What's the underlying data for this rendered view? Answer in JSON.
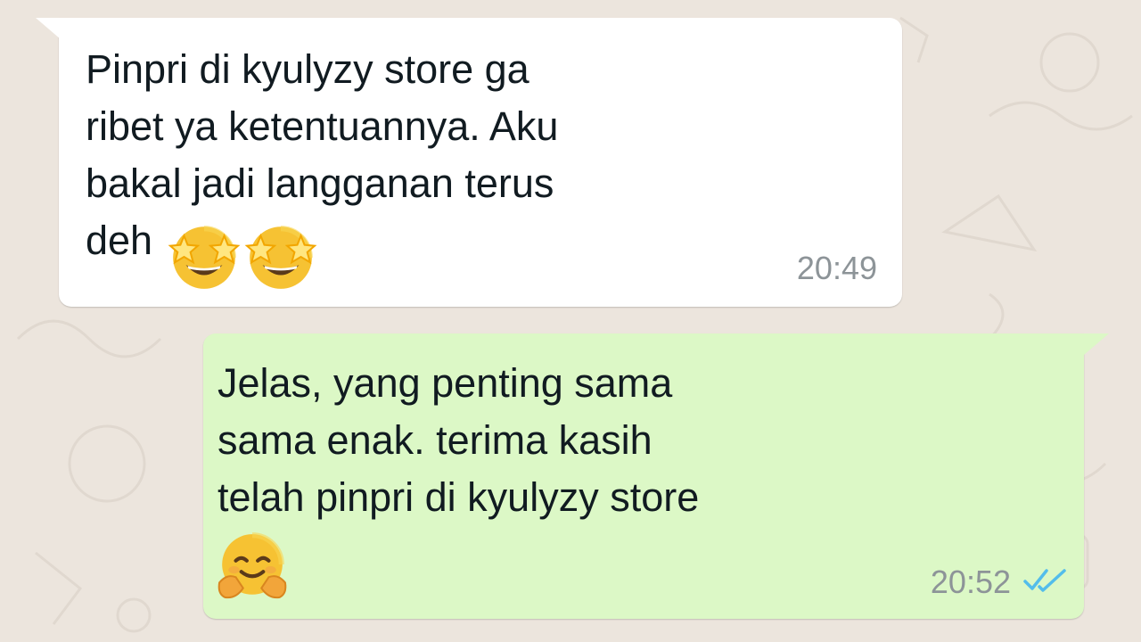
{
  "chat": {
    "messages": [
      {
        "direction": "incoming",
        "text": "Pinpri di kyulyzy store ga\nribet ya ketentuannya. Aku\nbakal jadi langganan terus\ndeh",
        "emojis": [
          "star-struck-emoji",
          "star-struck-emoji"
        ],
        "time": "20:49"
      },
      {
        "direction": "outgoing",
        "text": "Jelas, yang penting sama\nsama enak. terima kasih\ntelah pinpri di kyulyzy store",
        "emojis": [
          "hugging-face-emoji"
        ],
        "time": "20:52",
        "status": "read",
        "status_icon": "double-check-icon"
      }
    ]
  },
  "colors": {
    "background": "#ece5dd",
    "incoming_bubble": "#ffffff",
    "outgoing_bubble": "#dcf8c6",
    "text": "#111b21",
    "time": "#8d9498",
    "read_ticks": "#53bdeb"
  }
}
